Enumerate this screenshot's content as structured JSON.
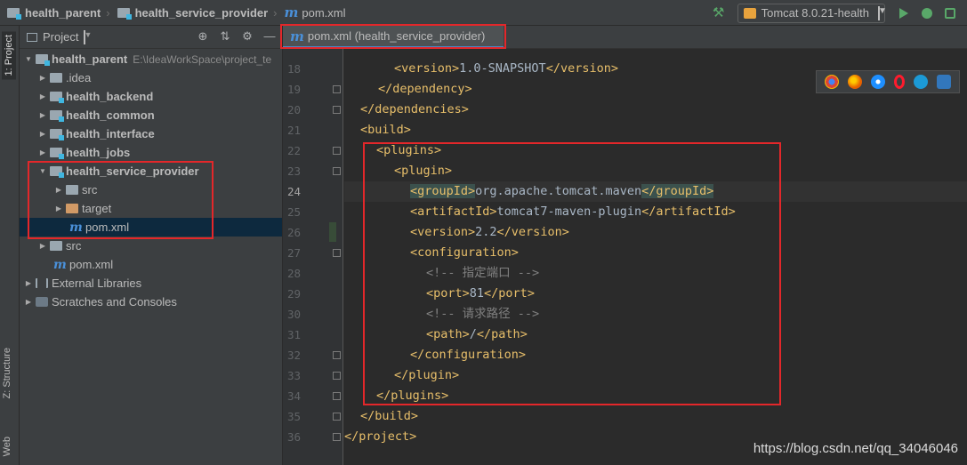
{
  "navbar": {
    "breadcrumbs": [
      "health_parent",
      "health_service_provider",
      "pom.xml"
    ],
    "run_config": "Tomcat 8.0.21-health"
  },
  "tool_stripe": {
    "project_tab": "1: Project",
    "structure_tab": "Z: Structure",
    "web_tab": "Web"
  },
  "project_panel": {
    "title": "Project",
    "tree": [
      {
        "label": "health_parent",
        "hint": "E:\\IdeaWorkSpace\\project_te",
        "bold": true,
        "expanded": true
      },
      {
        "label": ".idea",
        "bold": false
      },
      {
        "label": "health_backend",
        "bold": true
      },
      {
        "label": "health_common",
        "bold": true
      },
      {
        "label": "health_interface",
        "bold": true
      },
      {
        "label": "health_jobs",
        "bold": true
      },
      {
        "label": "health_service_provider",
        "bold": true,
        "expanded": true
      },
      {
        "label": "src",
        "bold": false
      },
      {
        "label": "target",
        "bold": false
      },
      {
        "label": "pom.xml",
        "bold": false
      },
      {
        "label": "src",
        "bold": false
      },
      {
        "label": "pom.xml",
        "bold": false
      },
      {
        "label": "External Libraries",
        "bold": false
      },
      {
        "label": "Scratches and Consoles",
        "bold": false
      }
    ]
  },
  "editor": {
    "tab_label": "pom.xml (health_service_provider)",
    "line_numbers": [
      "18",
      "19",
      "20",
      "21",
      "22",
      "23",
      "24",
      "25",
      "26",
      "27",
      "28",
      "29",
      "30",
      "31",
      "32",
      "33",
      "34",
      "35",
      "36"
    ],
    "lines": [
      {
        "parts": [
          [
            "tag",
            "<version>"
          ],
          [
            "txt",
            "1.0-SNAPSHOT"
          ],
          [
            "tag",
            "</version>"
          ]
        ]
      },
      {
        "parts": [
          [
            "tag",
            "</dependency>"
          ]
        ]
      },
      {
        "parts": [
          [
            "tag",
            "</dependencies>"
          ]
        ]
      },
      {
        "parts": [
          [
            "tag",
            "<build>"
          ]
        ]
      },
      {
        "parts": [
          [
            "tag",
            "<plugins>"
          ]
        ]
      },
      {
        "parts": [
          [
            "tag",
            "<plugin>"
          ]
        ]
      },
      {
        "parts": [
          [
            "tag",
            "<groupId>"
          ],
          [
            "txt",
            "org.apache.tomcat.maven"
          ],
          [
            "tag",
            "</groupId>"
          ]
        ]
      },
      {
        "parts": [
          [
            "tag",
            "<artifactId>"
          ],
          [
            "txt",
            "tomcat7-maven-plugin"
          ],
          [
            "tag",
            "</artifactId>"
          ]
        ]
      },
      {
        "parts": [
          [
            "tag",
            "<version>"
          ],
          [
            "txt",
            "2.2"
          ],
          [
            "tag",
            "</version>"
          ]
        ]
      },
      {
        "parts": [
          [
            "tag",
            "<configuration>"
          ]
        ]
      },
      {
        "parts": [
          [
            "cmt",
            "<!-- 指定端口 -->"
          ]
        ]
      },
      {
        "parts": [
          [
            "tag",
            "<port>"
          ],
          [
            "txt",
            "81"
          ],
          [
            "tag",
            "</port>"
          ]
        ]
      },
      {
        "parts": [
          [
            "cmt",
            "<!-- 请求路径 -->"
          ]
        ]
      },
      {
        "parts": [
          [
            "tag",
            "<path>"
          ],
          [
            "txt",
            "/"
          ],
          [
            "tag",
            "</path>"
          ]
        ]
      },
      {
        "parts": [
          [
            "tag",
            "</configuration>"
          ]
        ]
      },
      {
        "parts": [
          [
            "tag",
            "</plugin>"
          ]
        ]
      },
      {
        "parts": [
          [
            "tag",
            "</plugins>"
          ]
        ]
      },
      {
        "parts": [
          [
            "tag",
            "</build>"
          ]
        ]
      },
      {
        "parts": [
          [
            "tag",
            "</project>"
          ]
        ]
      }
    ]
  },
  "watermark": "https://blog.csdn.net/qq_34046046",
  "colors": {
    "annotation_red": "#e3272a",
    "xml_tag": "#e8bf6a",
    "comment": "#808080",
    "selection": "#0d293e"
  }
}
